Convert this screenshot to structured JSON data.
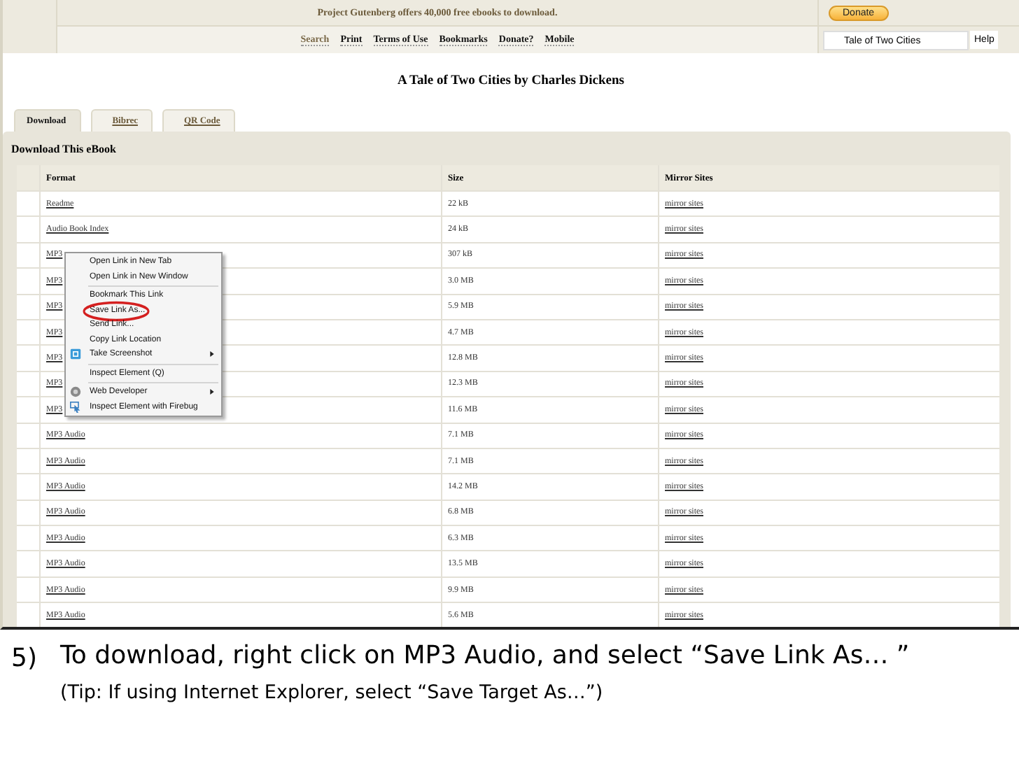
{
  "banner": {
    "text": "Project Gutenberg offers 40,000 free ebooks to download.",
    "donate_button": "Donate"
  },
  "nav": [
    {
      "label": "Search",
      "selected": true
    },
    {
      "label": "Print",
      "selected": false
    },
    {
      "label": "Terms of Use",
      "selected": false
    },
    {
      "label": "Bookmarks",
      "selected": false
    },
    {
      "label": "Donate?",
      "selected": false
    },
    {
      "label": "Mobile",
      "selected": false
    }
  ],
  "search": {
    "value": "Tale of Two Cities"
  },
  "help": "Help",
  "title": "A Tale of Two Cities by Charles Dickens",
  "tabs": [
    {
      "label": "Download",
      "selected": true
    },
    {
      "label": "Bibrec",
      "selected": false
    },
    {
      "label": "QR Code",
      "selected": false
    }
  ],
  "section_title": "Download This eBook",
  "table": {
    "columns": [
      "Format",
      "Size",
      "Mirror Sites"
    ],
    "rows": [
      {
        "format": "Readme",
        "size": "22 kB",
        "mirror": "mirror sites"
      },
      {
        "format": "Audio Book Index",
        "size": "24 kB",
        "mirror": "mirror sites"
      },
      {
        "format": "MP3",
        "size": "307 kB",
        "mirror": "mirror sites"
      },
      {
        "format": "MP3",
        "size": "3.0 MB",
        "mirror": "mirror sites"
      },
      {
        "format": "MP3",
        "size": "5.9 MB",
        "mirror": "mirror sites"
      },
      {
        "format": "MP3",
        "size": "4.7 MB",
        "mirror": "mirror sites"
      },
      {
        "format": "MP3",
        "size": "12.8 MB",
        "mirror": "mirror sites"
      },
      {
        "format": "MP3",
        "size": "12.3 MB",
        "mirror": "mirror sites"
      },
      {
        "format": "MP3",
        "size": "11.6 MB",
        "mirror": "mirror sites"
      },
      {
        "format": "MP3 Audio",
        "size": "7.1 MB",
        "mirror": "mirror sites"
      },
      {
        "format": "MP3 Audio",
        "size": "7.1 MB",
        "mirror": "mirror sites"
      },
      {
        "format": "MP3 Audio",
        "size": "14.2 MB",
        "mirror": "mirror sites"
      },
      {
        "format": "MP3 Audio",
        "size": "6.8 MB",
        "mirror": "mirror sites"
      },
      {
        "format": "MP3 Audio",
        "size": "6.3 MB",
        "mirror": "mirror sites"
      },
      {
        "format": "MP3 Audio",
        "size": "13.5 MB",
        "mirror": "mirror sites"
      },
      {
        "format": "MP3 Audio",
        "size": "9.9 MB",
        "mirror": "mirror sites"
      },
      {
        "format": "MP3 Audio",
        "size": "5.6 MB",
        "mirror": "mirror sites"
      }
    ]
  },
  "context_menu": {
    "items": [
      {
        "kind": "plain",
        "label": "Open Link in New Tab",
        "submenu": false,
        "circled": false
      },
      {
        "kind": "plain",
        "label": "Open Link in New Window",
        "submenu": false,
        "circled": false
      },
      {
        "kind": "separator"
      },
      {
        "kind": "plain",
        "label": "Bookmark This Link",
        "submenu": false,
        "circled": false
      },
      {
        "kind": "plain",
        "label": "Save Link As...",
        "submenu": false,
        "circled": true
      },
      {
        "kind": "plain",
        "label": "Send Link...",
        "submenu": false,
        "circled": false
      },
      {
        "kind": "plain",
        "label": "Copy Link Location",
        "submenu": false,
        "circled": false
      },
      {
        "kind": "screenshot",
        "label": "Take Screenshot",
        "submenu": true,
        "circled": false
      },
      {
        "kind": "separator"
      },
      {
        "kind": "plain",
        "label": "Inspect Element (Q)",
        "submenu": false,
        "circled": false
      },
      {
        "kind": "separator"
      },
      {
        "kind": "developer",
        "label": "Web Developer",
        "submenu": true,
        "circled": false
      },
      {
        "kind": "firebug",
        "label": "Inspect Element with Firebug",
        "submenu": false,
        "circled": false
      }
    ]
  },
  "caption": {
    "number": "5)",
    "text": "To download, right click on MP3 Audio, and select “Save Link As… ”",
    "tip": "(Tip: If using Internet Explorer, select “Save Target As…”)"
  }
}
